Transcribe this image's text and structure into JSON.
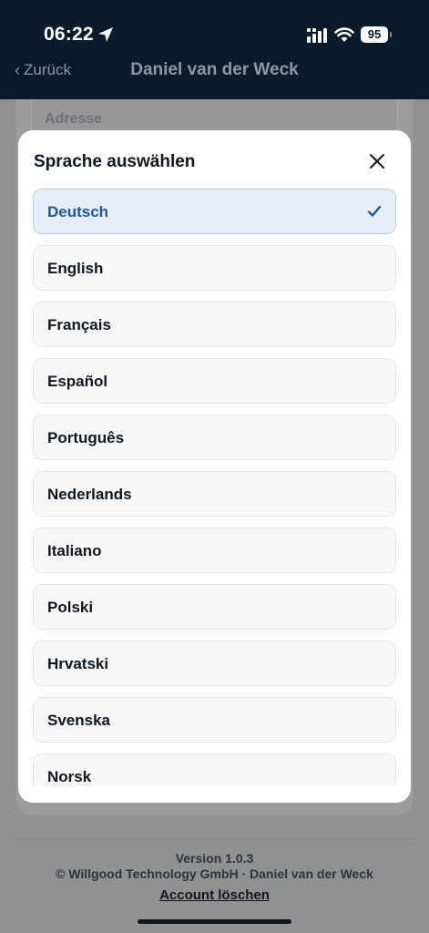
{
  "status_bar": {
    "time": "06:22",
    "battery": "95"
  },
  "nav": {
    "back_label": "Zurück",
    "back_chevron": "‹",
    "title": "Daniel van der Weck"
  },
  "background": {
    "field_label": "Adresse",
    "version": "Version 1.0.3",
    "copyright": "© Willgood Technology GmbH · Daniel van der Weck",
    "delete_account": "Account löschen"
  },
  "modal": {
    "title": "Sprache auswählen",
    "close_icon": "close-icon",
    "selected_check_icon": "checkmark-icon",
    "languages": [
      {
        "label": "Deutsch",
        "selected": true
      },
      {
        "label": "English",
        "selected": false
      },
      {
        "label": "Français",
        "selected": false
      },
      {
        "label": "Español",
        "selected": false
      },
      {
        "label": "Português",
        "selected": false
      },
      {
        "label": "Nederlands",
        "selected": false
      },
      {
        "label": "Italiano",
        "selected": false
      },
      {
        "label": "Polski",
        "selected": false
      },
      {
        "label": "Hrvatski",
        "selected": false
      },
      {
        "label": "Svenska",
        "selected": false
      },
      {
        "label": "Norsk",
        "selected": false
      }
    ]
  },
  "colors": {
    "topbar_bg": "#0b1a2a",
    "selected_bg": "#e6eefa",
    "selected_text": "#1d57a0",
    "overlay": "#8f9193"
  }
}
